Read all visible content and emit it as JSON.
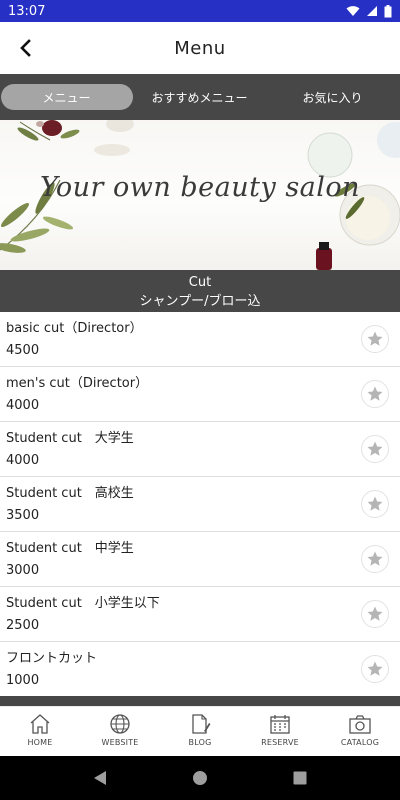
{
  "status_bar": {
    "time": "13:07"
  },
  "header": {
    "title": "Menu"
  },
  "tabs": [
    {
      "label": "メニュー",
      "active": true
    },
    {
      "label": "おすすめメニュー",
      "active": false
    },
    {
      "label": "お気に入り",
      "active": false
    }
  ],
  "banner": {
    "text": "Your own beauty salon"
  },
  "section": {
    "title": "Cut",
    "subtitle": "シャンプー/ブロー込"
  },
  "items": [
    {
      "name": "basic cut（Director）",
      "price": "4500"
    },
    {
      "name": "men's cut（Director）",
      "price": "4000"
    },
    {
      "name": "Student cut　大学生",
      "price": "4000"
    },
    {
      "name": "Student cut　高校生",
      "price": "3500"
    },
    {
      "name": "Student cut　中学生",
      "price": "3000"
    },
    {
      "name": "Student cut　小学生以下",
      "price": "2500"
    },
    {
      "name": "フロントカット",
      "price": "1000"
    }
  ],
  "bottom_nav": [
    {
      "label": "HOME",
      "icon": "home-icon"
    },
    {
      "label": "WEBSITE",
      "icon": "globe-icon"
    },
    {
      "label": "BLOG",
      "icon": "blog-icon"
    },
    {
      "label": "RESERVE",
      "icon": "calendar-icon"
    },
    {
      "label": "CATALOG",
      "icon": "camera-icon"
    }
  ],
  "colors": {
    "status_bar": "#2730c4",
    "bar_dark": "#474747",
    "tab_active": "#a5a5a5",
    "star": "#b5b5b5"
  }
}
